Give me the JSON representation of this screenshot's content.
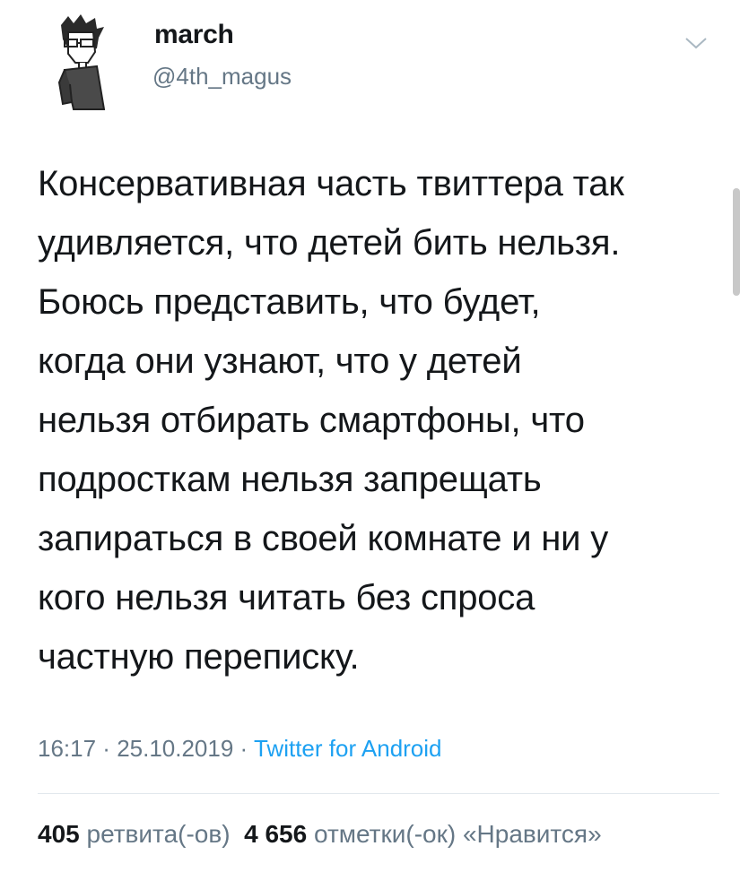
{
  "author": {
    "display_name": "march",
    "handle": "@4th_magus",
    "avatar_icon": "avatar-drawing-icon"
  },
  "menu": {
    "caret_icon": "chevron-down-icon"
  },
  "tweet": {
    "lines": [
      "Консервативная часть твиттера так",
      "удивляется, что детей бить нельзя.",
      "Боюсь представить, что будет,",
      "когда они узнают, что у детей",
      "нельзя отбирать смартфоны, что",
      "подросткам нельзя запрещать",
      "запираться в своей комнате и ни у",
      "кого нельзя читать без спроса",
      "частную переписку."
    ]
  },
  "meta": {
    "time": "16:17",
    "sep1": " · ",
    "date": "25.10.2019",
    "sep2": " · ",
    "source": "Twitter for Android"
  },
  "stats": {
    "retweets_count": "405",
    "retweets_label": "ретвита(-ов)",
    "likes_count": "4 656",
    "likes_label": "отметки(-ок) «Нравится»"
  },
  "colors": {
    "text": "#14171a",
    "secondary": "#657786",
    "link": "#1da1f2",
    "divider": "#e1e8ed"
  }
}
